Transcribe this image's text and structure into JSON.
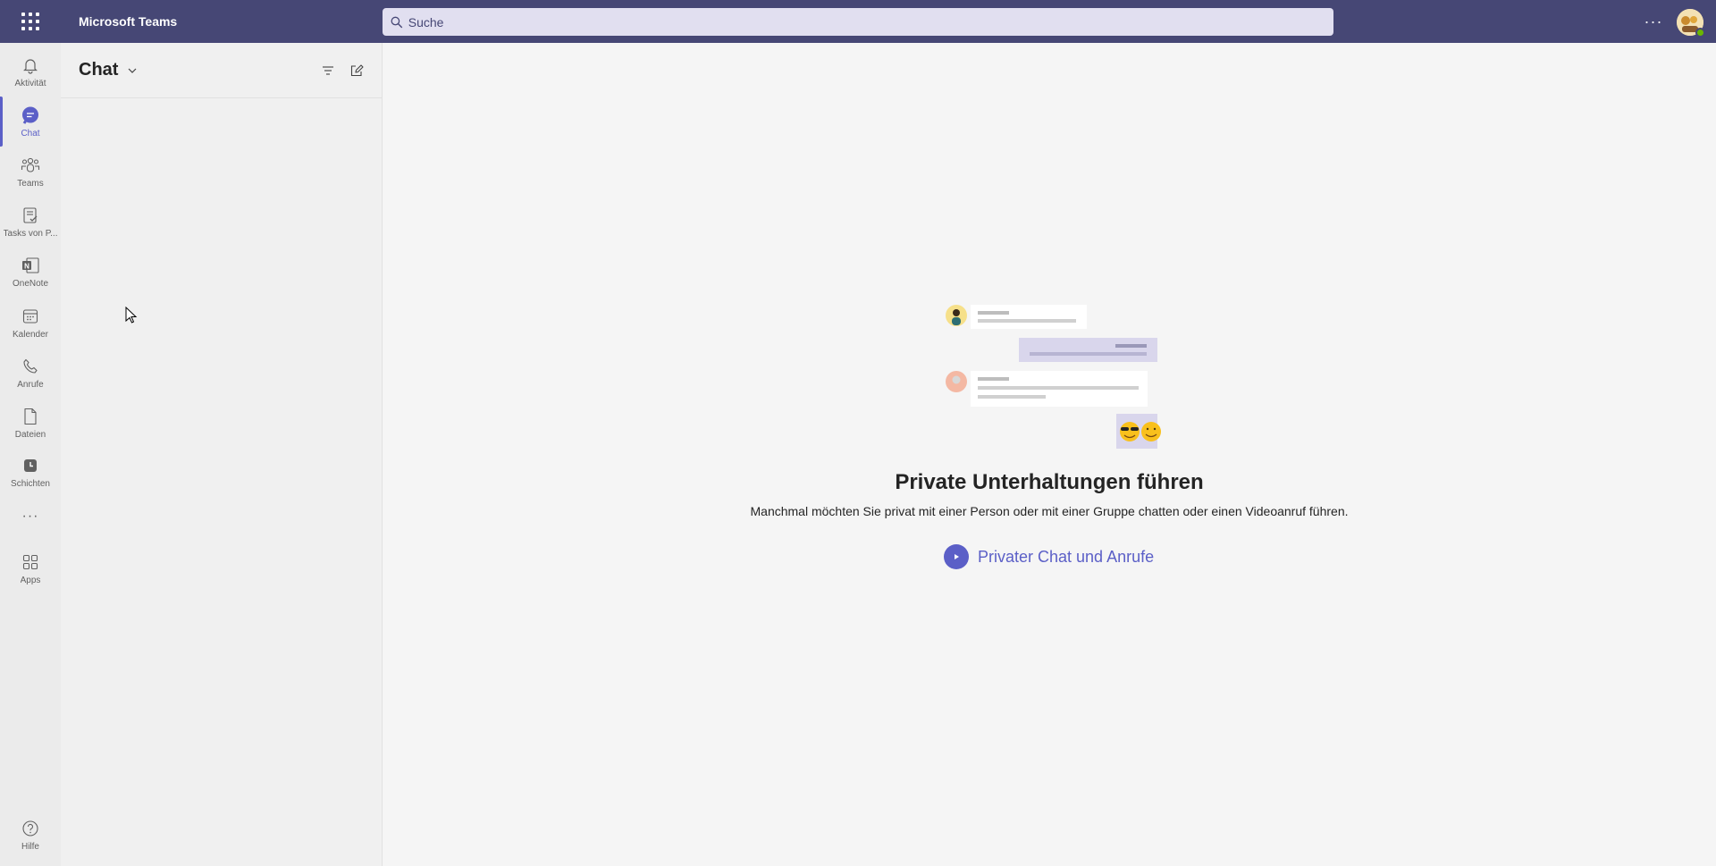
{
  "topbar": {
    "app_title": "Microsoft Teams",
    "search_placeholder": "Suche",
    "more_label": "···",
    "accent_color": "#464775"
  },
  "rail": {
    "items": [
      {
        "label": "Aktivität",
        "icon": "bell-icon"
      },
      {
        "label": "Chat",
        "icon": "chat-bubble-icon",
        "active": true
      },
      {
        "label": "Teams",
        "icon": "teams-people-icon"
      },
      {
        "label": "Tasks von P...",
        "icon": "tasks-clipboard-icon"
      },
      {
        "label": "OneNote",
        "icon": "onenote-icon"
      },
      {
        "label": "Kalender",
        "icon": "calendar-icon"
      },
      {
        "label": "Anrufe",
        "icon": "phone-icon"
      },
      {
        "label": "Dateien",
        "icon": "file-icon"
      },
      {
        "label": "Schichten",
        "icon": "shifts-clock-icon"
      },
      {
        "label": "Apps",
        "icon": "apps-grid-icon"
      },
      {
        "label": "Hilfe",
        "icon": "help-icon"
      }
    ],
    "more_dots": "···",
    "active_color": "#5b5fc7"
  },
  "chatpanel": {
    "title": "Chat"
  },
  "main": {
    "headline": "Private Unterhaltungen führen",
    "subline": "Manchmal möchten Sie privat mit einer Person oder mit einer Gruppe chatten oder einen Videoanruf führen.",
    "cta_label": "Privater Chat und Anrufe"
  }
}
